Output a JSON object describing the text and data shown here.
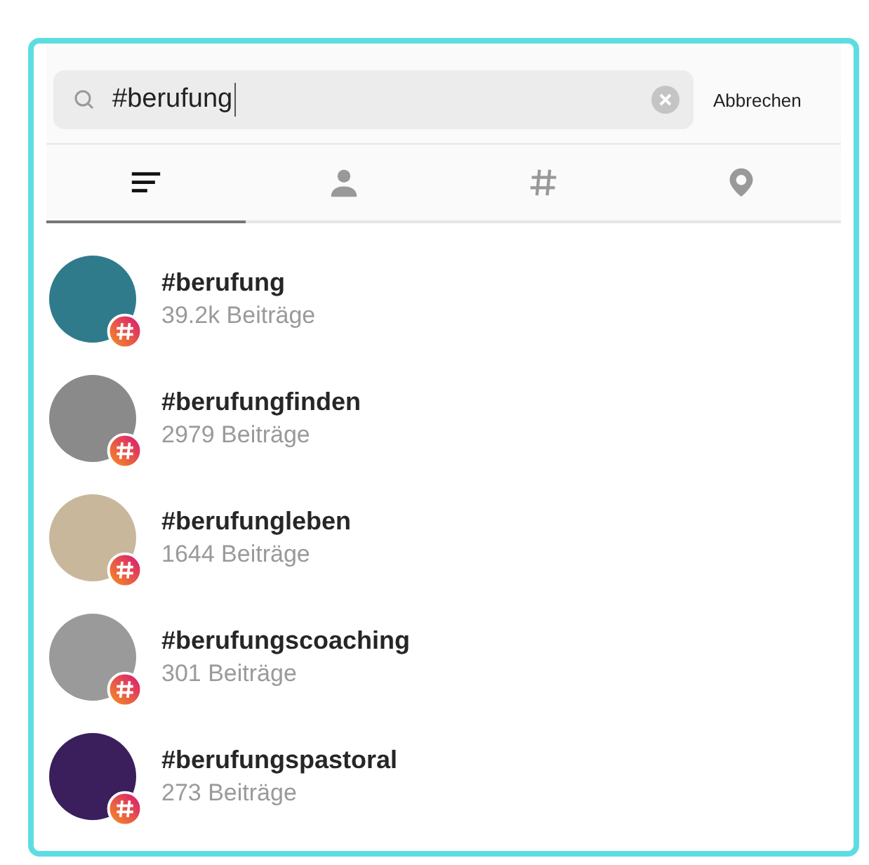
{
  "search": {
    "value": "#berufung",
    "cancel": "Abbrechen"
  },
  "tabs": [
    {
      "kind": "top",
      "selected": true
    },
    {
      "kind": "people",
      "selected": false
    },
    {
      "kind": "tags",
      "selected": false
    },
    {
      "kind": "places",
      "selected": false
    }
  ],
  "results": [
    {
      "tag": "#berufung",
      "posts": "39.2k Beiträge"
    },
    {
      "tag": "#berufungfinden",
      "posts": "2979 Beiträge"
    },
    {
      "tag": "#berufungleben",
      "posts": "1644 Beiträge"
    },
    {
      "tag": "#berufungscoaching",
      "posts": "301 Beiträge"
    },
    {
      "tag": "#berufungspastoral",
      "posts": "273 Beiträge"
    }
  ]
}
